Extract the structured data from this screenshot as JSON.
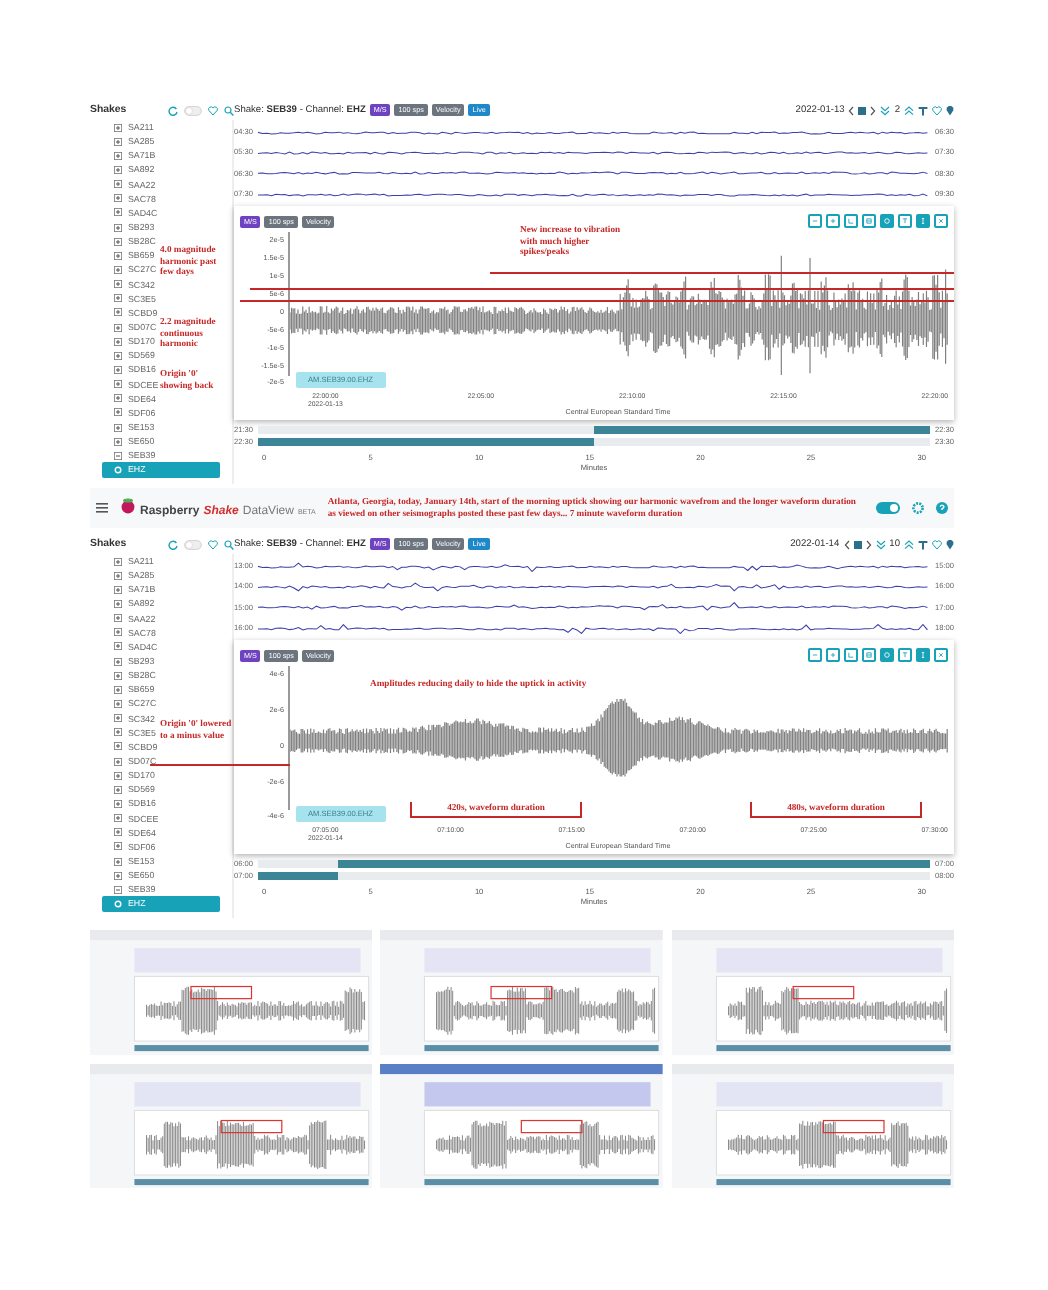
{
  "panels": [
    {
      "sidebar_title": "Shakes",
      "stations": [
        {
          "label": "SA211",
          "expanded": false
        },
        {
          "label": "SA285",
          "expanded": false
        },
        {
          "label": "SA71B",
          "expanded": false
        },
        {
          "label": "SA892",
          "expanded": false
        },
        {
          "label": "SAA22",
          "expanded": false
        },
        {
          "label": "SAC78",
          "expanded": false
        },
        {
          "label": "SAD4C",
          "expanded": false
        },
        {
          "label": "SB293",
          "expanded": false
        },
        {
          "label": "SB28C",
          "expanded": false
        },
        {
          "label": "SB659",
          "expanded": false
        },
        {
          "label": "SC27C",
          "expanded": false
        },
        {
          "label": "SC342",
          "expanded": false
        },
        {
          "label": "SC3E5",
          "expanded": false
        },
        {
          "label": "SCBD9",
          "expanded": false
        },
        {
          "label": "SD07C",
          "expanded": false
        },
        {
          "label": "SD170",
          "expanded": false
        },
        {
          "label": "SD569",
          "expanded": false
        },
        {
          "label": "SDB16",
          "expanded": false
        },
        {
          "label": "SDCEE",
          "expanded": false
        },
        {
          "label": "SDE64",
          "expanded": false
        },
        {
          "label": "SDF06",
          "expanded": false
        },
        {
          "label": "SE153",
          "expanded": false
        },
        {
          "label": "SE650",
          "expanded": false
        },
        {
          "label": "SEB39",
          "expanded": true,
          "children": [
            {
              "label": "EHZ",
              "selected": true
            }
          ]
        }
      ],
      "title": "Shake: **SEB39** - Channel: **EHZ**",
      "tags": [
        {
          "label": "M/S",
          "kind": "unit"
        },
        {
          "label": "100 sps",
          "kind": "rate"
        },
        {
          "label": "Velocity",
          "kind": "mode"
        },
        {
          "label": "Live",
          "kind": "stream"
        }
      ],
      "date": "2022-01-13",
      "count": "2",
      "helicorder": {
        "left_times": [
          "04:30",
          "05:30",
          "06:30",
          "07:30"
        ],
        "right_times": [
          "06:30",
          "07:30",
          "08:30",
          "09:30"
        ]
      },
      "chart": {
        "tags": [
          {
            "label": "M/S",
            "kind": "unit"
          },
          {
            "label": "100 sps",
            "kind": "rate"
          },
          {
            "label": "Velocity",
            "kind": "mode"
          }
        ],
        "toolbar": [
          {
            "kind": "zoom-out",
            "on": false
          },
          {
            "kind": "zoom-in",
            "on": false
          },
          {
            "kind": "scale",
            "on": false
          },
          {
            "kind": "grid",
            "on": false
          },
          {
            "kind": "globe",
            "on": true
          },
          {
            "kind": "filter",
            "on": false
          },
          {
            "kind": "amplitude",
            "on": true
          },
          {
            "kind": "close",
            "on": false
          }
        ],
        "y_ticks": [
          "2e-5",
          "1.5e-5",
          "1e-5",
          "5e-6",
          "0",
          "-5e-6",
          "-1e-5",
          "-1.5e-5",
          "-2e-5"
        ],
        "x_ticks": [
          "22:00:00",
          "22:05:00",
          "22:10:00",
          "22:15:00",
          "22:20:00"
        ],
        "x_date": "2022-01-13",
        "x_title": "Central European Standard Time",
        "legend": "AM.SEB39.00.EHZ",
        "annotations": [
          {
            "text": "4.0 magnitude harmonic past few days",
            "kind": "note"
          },
          {
            "text": "New increase to vibration with much higher spikes/peaks",
            "kind": "note"
          },
          {
            "text": "2.2 magnitude continuous harmonic",
            "kind": "note"
          },
          {
            "text": "Origin '0' showing back",
            "kind": "note"
          }
        ]
      },
      "minutes": {
        "rows": [
          {
            "left": "21:30",
            "right": "22:30",
            "level": 0.5,
            "kind": "end"
          },
          {
            "left": "22:30",
            "right": "23:30",
            "level": 0.5,
            "kind": "start"
          }
        ],
        "ticks": [
          "0",
          "5",
          "10",
          "15",
          "20",
          "25",
          "30"
        ],
        "label": "Minutes"
      }
    },
    {
      "appbar": {
        "brand": "Raspberry",
        "brand_accent": "Shake",
        "product": "DataView",
        "badge": "BETA",
        "caption": "Atlanta, Georgia, today, January 14th, start of the morning uptick showing our harmonic wavefrom and the longer waveform duration as viewed on other seismographs posted these past few days... 7 minute waveform duration",
        "live_on": true
      },
      "sidebar_title": "Shakes",
      "stations": [
        {
          "label": "SA211",
          "expanded": false
        },
        {
          "label": "SA285",
          "expanded": false
        },
        {
          "label": "SA71B",
          "expanded": false
        },
        {
          "label": "SA892",
          "expanded": false
        },
        {
          "label": "SAA22",
          "expanded": false
        },
        {
          "label": "SAC78",
          "expanded": false
        },
        {
          "label": "SAD4C",
          "expanded": false
        },
        {
          "label": "SB293",
          "expanded": false
        },
        {
          "label": "SB28C",
          "expanded": false
        },
        {
          "label": "SB659",
          "expanded": false
        },
        {
          "label": "SC27C",
          "expanded": false
        },
        {
          "label": "SC342",
          "expanded": false
        },
        {
          "label": "SC3E5",
          "expanded": false
        },
        {
          "label": "SCBD9",
          "expanded": false
        },
        {
          "label": "SD07C",
          "expanded": false
        },
        {
          "label": "SD170",
          "expanded": false
        },
        {
          "label": "SD569",
          "expanded": false
        },
        {
          "label": "SDB16",
          "expanded": false
        },
        {
          "label": "SDCEE",
          "expanded": false
        },
        {
          "label": "SDE64",
          "expanded": false
        },
        {
          "label": "SDF06",
          "expanded": false
        },
        {
          "label": "SE153",
          "expanded": false
        },
        {
          "label": "SE650",
          "expanded": false
        },
        {
          "label": "SEB39",
          "expanded": true,
          "children": [
            {
              "label": "EHZ",
              "selected": true
            }
          ]
        }
      ],
      "title": "Shake: **SEB39** - Channel: **EHZ**",
      "tags": [
        {
          "label": "M/S",
          "kind": "unit"
        },
        {
          "label": "100 sps",
          "kind": "rate"
        },
        {
          "label": "Velocity",
          "kind": "mode"
        },
        {
          "label": "Live",
          "kind": "stream"
        }
      ],
      "date": "2022-01-14",
      "count": "10",
      "helicorder": {
        "left_times": [
          "13:00",
          "14:00",
          "15:00",
          "16:00"
        ],
        "right_times": [
          "15:00",
          "16:00",
          "17:00",
          "18:00"
        ]
      },
      "chart": {
        "tags": [
          {
            "label": "M/S",
            "kind": "unit"
          },
          {
            "label": "100 sps",
            "kind": "rate"
          },
          {
            "label": "Velocity",
            "kind": "mode"
          }
        ],
        "toolbar": [
          {
            "kind": "zoom-out",
            "on": false
          },
          {
            "kind": "zoom-in",
            "on": false
          },
          {
            "kind": "scale",
            "on": false
          },
          {
            "kind": "grid",
            "on": false
          },
          {
            "kind": "globe",
            "on": true
          },
          {
            "kind": "filter",
            "on": false
          },
          {
            "kind": "amplitude",
            "on": true
          },
          {
            "kind": "close",
            "on": false
          }
        ],
        "y_ticks": [
          "4e-6",
          "2e-6",
          "0",
          "-2e-6",
          "-4e-6"
        ],
        "x_ticks": [
          "07:05:00",
          "07:10:00",
          "07:15:00",
          "07:20:00",
          "07:25:00",
          "07:30:00"
        ],
        "x_date": "2022-01-14",
        "x_title": "Central European Standard Time",
        "legend": "AM.SEB39.00.EHZ",
        "annotations": [
          {
            "text": "Amplitudes reducing daily to hide the uptick in activity",
            "kind": "note"
          },
          {
            "text": "Origin '0' lowered to a minus value",
            "kind": "note"
          },
          {
            "text": "420s, waveform duration",
            "kind": "bracket"
          },
          {
            "text": "480s, waveform duration",
            "kind": "bracket"
          }
        ]
      },
      "minutes": {
        "rows": [
          {
            "left": "06:00",
            "right": "07:00",
            "level": 0.88,
            "kind": "end"
          },
          {
            "left": "07:00",
            "right": "08:00",
            "level": 0.12,
            "kind": "start"
          }
        ],
        "ticks": [
          "0",
          "5",
          "10",
          "15",
          "20",
          "25",
          "30"
        ],
        "label": "Minutes"
      }
    }
  ]
}
